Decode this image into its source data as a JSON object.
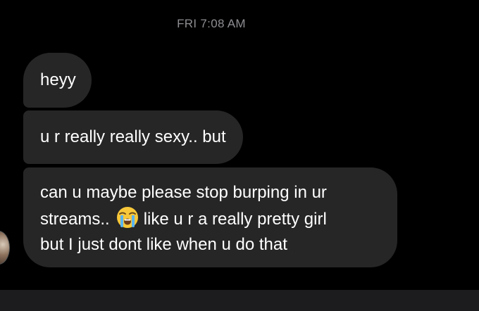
{
  "thread": {
    "timestamp": "FRI 7:08 AM",
    "messages": [
      {
        "lines": [
          "heyy"
        ]
      },
      {
        "lines": [
          "u r really really sexy.. but"
        ]
      },
      {
        "lines": [
          "can u maybe please stop burping in ur",
          "streams..",
          "like u r a really pretty girl",
          "but I just dont like when u do that"
        ],
        "emoji": "loudly-crying-face"
      }
    ]
  },
  "colors": {
    "background": "#000000",
    "bubble": "#262626",
    "timestamp": "#8e8e93",
    "text": "#ffffff"
  }
}
